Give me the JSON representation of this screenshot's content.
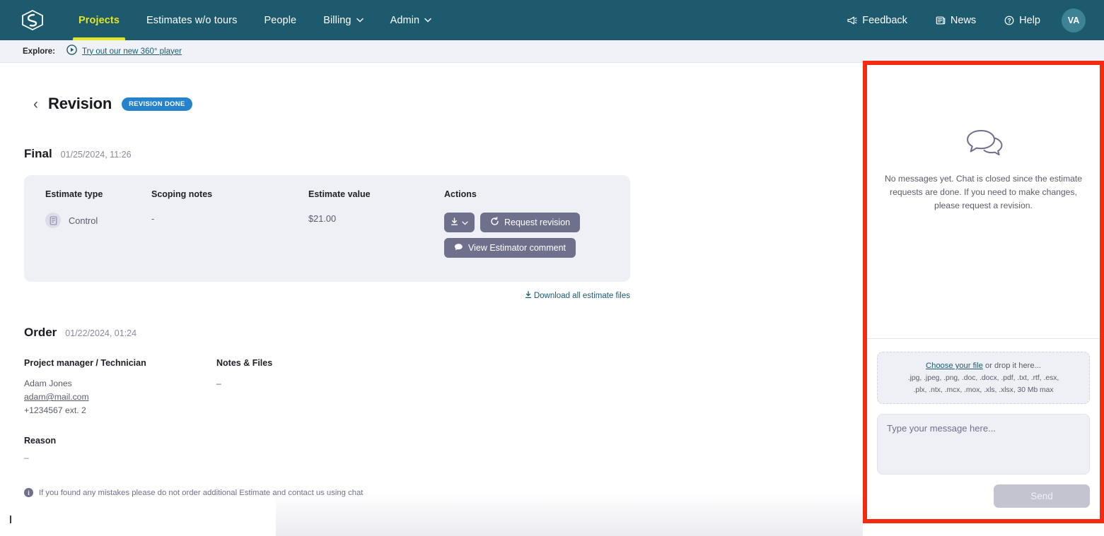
{
  "nav": {
    "logo_icon": "cube-logo-icon",
    "items": [
      {
        "label": "Projects",
        "active": true,
        "caret": ""
      },
      {
        "label": "Estimates w/o tours",
        "active": false,
        "caret": ""
      },
      {
        "label": "People",
        "active": false,
        "caret": ""
      },
      {
        "label": "Billing",
        "active": false,
        "caret": "⌄"
      },
      {
        "label": "Admin",
        "active": false,
        "caret": "⌄"
      }
    ],
    "right": [
      {
        "label": "Feedback",
        "icon": "megaphone-icon"
      },
      {
        "label": "News",
        "icon": "newspaper-icon"
      },
      {
        "label": "Help",
        "icon": "question-circle-icon"
      }
    ],
    "avatar_initials": "VA",
    "active_color": "#E0E620",
    "bar_color": "#1E5A6E"
  },
  "explore": {
    "label": "Explore:",
    "link": "Try out our new 360° player",
    "icon": "play-circle-icon"
  },
  "page": {
    "back_icon": "chevron-left-icon",
    "title": "Revision",
    "badge": "REVISION DONE",
    "badge_color": "#2682CB"
  },
  "final": {
    "title": "Final",
    "date": "01/25/2024, 11:26",
    "columns": [
      "Estimate type",
      "Scoping notes",
      "Estimate value",
      "Actions"
    ],
    "row": {
      "type": "Control",
      "type_icon": "document-icon",
      "scoping_notes": "-",
      "estimate_value": "$21.00"
    },
    "actions": {
      "download_icon": "download-icon",
      "download_caret": "⌄",
      "request_revision": "Request revision",
      "request_revision_icon": "refresh-icon",
      "view_comment": "View Estimator comment",
      "view_comment_icon": "comment-icon"
    },
    "download_all": "Download all estimate files",
    "download_all_icon": "download-icon"
  },
  "order": {
    "title": "Order",
    "date": "01/22/2024, 01:24",
    "pm_header": "Project manager / Technician",
    "pm_name": "Adam Jones",
    "pm_email": "adam@mail.com",
    "pm_phone": "+1234567 ext. 2",
    "notes_header": "Notes & Files",
    "notes_value": "–",
    "reason_header": "Reason",
    "reason_value": "–",
    "note": "If you found any mistakes please do not order additional Estimate and contact us using chat",
    "note_icon": "info-icon"
  },
  "chat": {
    "highlight_color": "#F32C11",
    "empty_icon": "chat-bubbles-icon",
    "empty_text": "No messages yet. Chat is closed since the estimate requests are done. If you need to make changes, please request a revision.",
    "upload_link": "Choose your file",
    "upload_rest": " or drop it here...",
    "upload_types_line1": ".jpg, .jpeg, .png, .doc, .docx, .pdf, .txt, .rtf, .esx,",
    "upload_types_line2": ".plx, .ntx, .mcx, .mox, .xls, .xlsx, 30 Mb max",
    "message_placeholder": "Type your message here...",
    "message_value": "",
    "send_label": "Send"
  }
}
